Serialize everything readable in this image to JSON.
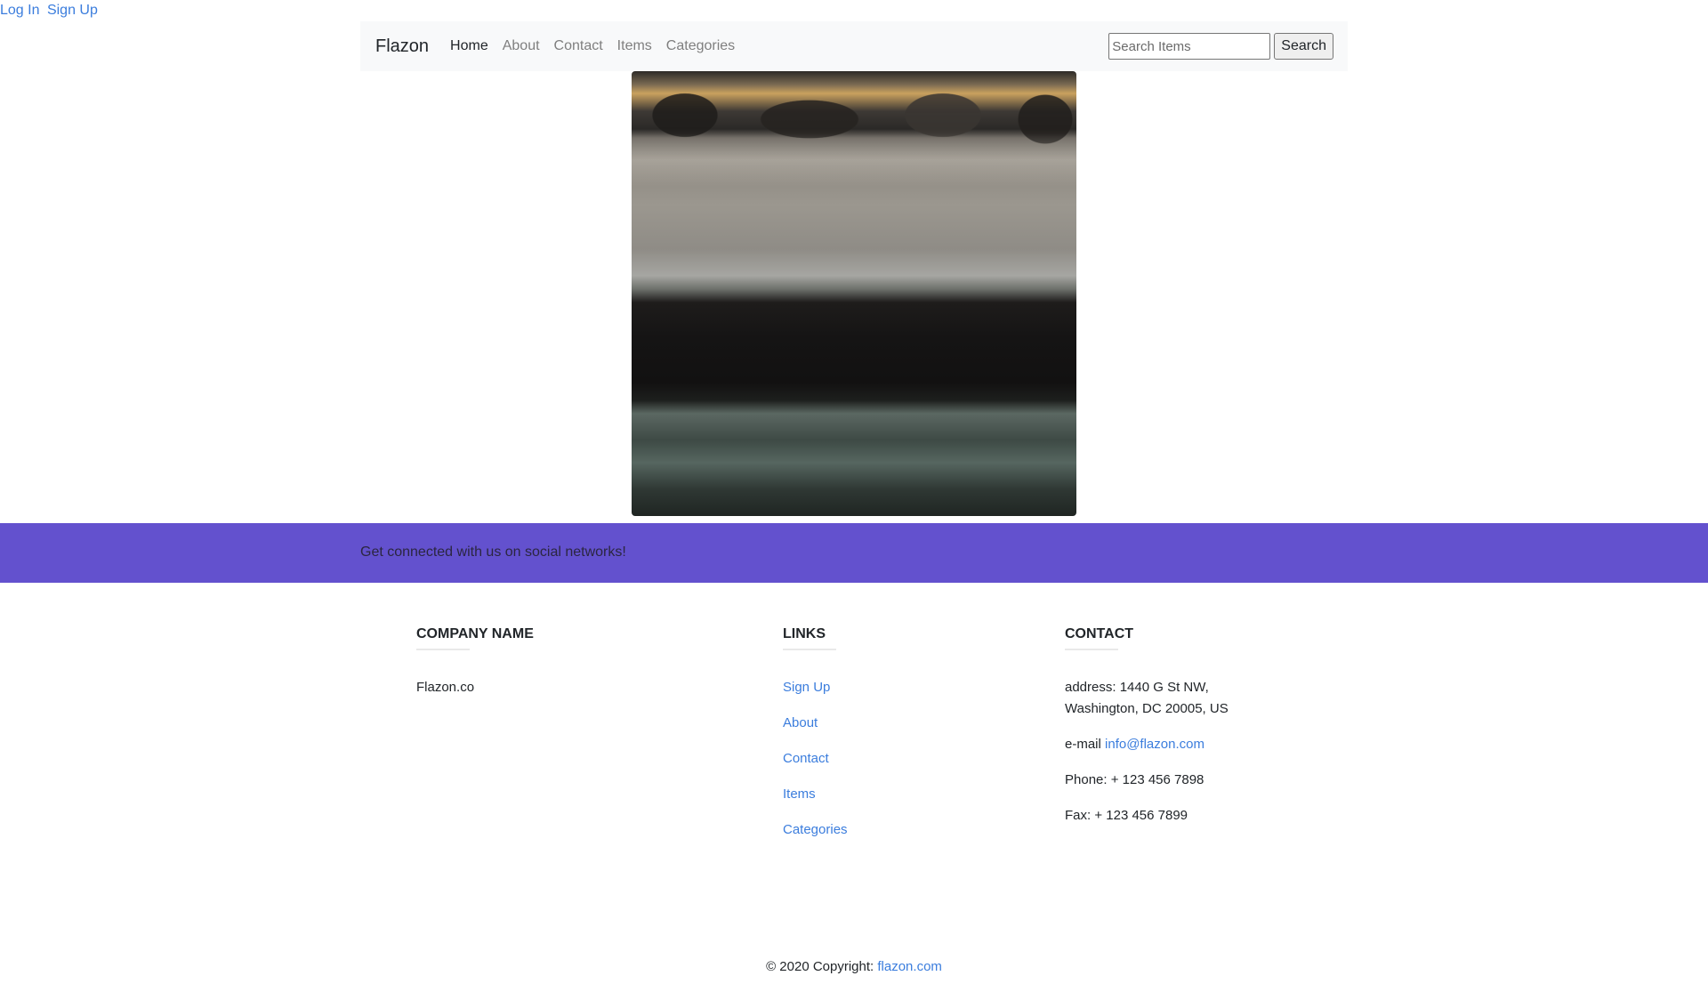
{
  "auth": {
    "login_label": "Log In",
    "signup_label": "Sign Up"
  },
  "navbar": {
    "brand": "Flazon",
    "items": [
      {
        "label": "Home",
        "active": true
      },
      {
        "label": "About",
        "active": false
      },
      {
        "label": "Contact",
        "active": false
      },
      {
        "label": "Items",
        "active": false
      },
      {
        "label": "Categories",
        "active": false
      }
    ],
    "search": {
      "placeholder": "Search Items",
      "value": "",
      "button_label": "Search"
    }
  },
  "hero": {
    "description": "frosted-field-photo"
  },
  "social": {
    "text": "Get connected with us on social networks!",
    "color": "#6351ce"
  },
  "footer": {
    "company": {
      "heading": "COMPANY NAME",
      "name": "Flazon.co"
    },
    "links": {
      "heading": "LINKS",
      "items": [
        "Sign Up",
        "About",
        "Contact",
        "Items",
        "Categories"
      ]
    },
    "contact": {
      "heading": "CONTACT",
      "address_line1": "address: 1440 G St NW,",
      "address_line2": "Washington, DC 20005, US",
      "email_label": "e-mail",
      "email": "info@flazon.com",
      "phone": "Phone: + 123 456 7898",
      "fax": "Fax: + 123 456 7899"
    },
    "copyright": {
      "text": "© 2020 Copyright:",
      "link": "flazon.com"
    }
  },
  "colors": {
    "link": "#3b7ddd",
    "navbar_bg": "#f8f9fa",
    "social_bar": "#6351ce"
  }
}
